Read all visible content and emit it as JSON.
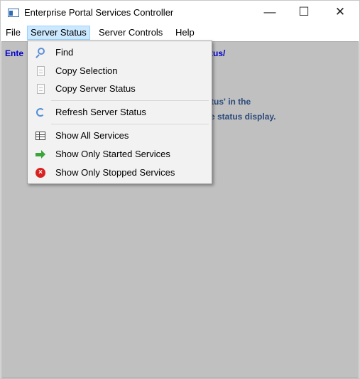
{
  "window": {
    "title": "Enterprise Portal Services Controller",
    "controls": {
      "minimize": "—",
      "maximize": "☐",
      "close": "✕"
    }
  },
  "menubar": {
    "items": [
      "File",
      "Server Status",
      "Server Controls",
      "Help"
    ],
    "active": "Server Status"
  },
  "client": {
    "line1_visible_start": "Ente",
    "line1_visible_end": "tus/",
    "line2_visible_end": "tus' in the",
    "line3_visible_end": "e status display."
  },
  "server_status_menu": {
    "items": [
      {
        "label": "Find",
        "icon": "magnifier-icon"
      },
      {
        "label": "Copy Selection",
        "icon": "document-icon"
      },
      {
        "label": "Copy Server Status",
        "icon": "document-icon"
      },
      {
        "label": "Refresh Server Status",
        "icon": "refresh-icon"
      },
      {
        "label": "Show All Services",
        "icon": "grid-icon"
      },
      {
        "label": "Show Only Started Services",
        "icon": "green-arrow-icon"
      },
      {
        "label": "Show Only Stopped Services",
        "icon": "red-stop-icon"
      }
    ]
  },
  "colors": {
    "client_bg": "#c0c0c0",
    "menu_bg": "#f2f2f2",
    "active_menu_bg": "#cce8ff",
    "link_blue": "#0000cc"
  }
}
